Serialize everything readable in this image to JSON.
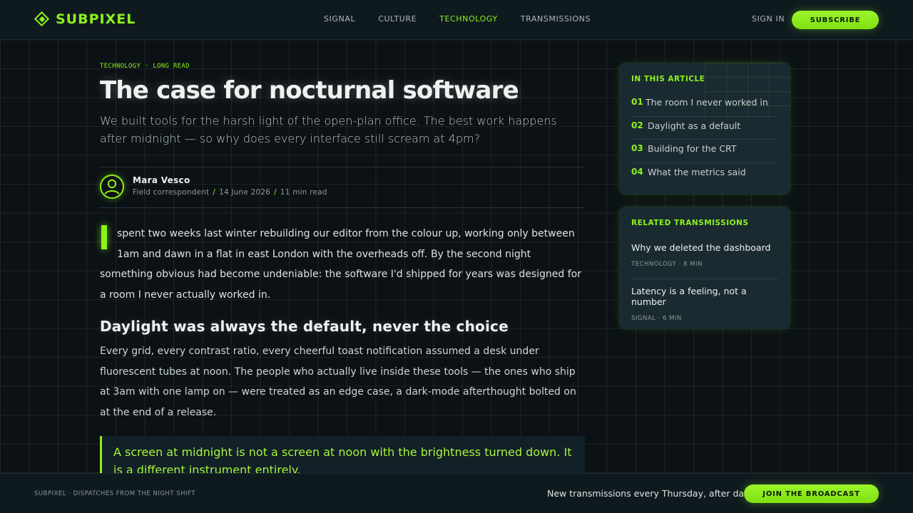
{
  "brand": {
    "name": "SUBPIXEL",
    "accent": "#8cf21b",
    "icon": "diamond-logo-icon"
  },
  "nav": {
    "items": [
      {
        "label": "SIGNAL",
        "active": false
      },
      {
        "label": "CULTURE",
        "active": false
      },
      {
        "label": "TECHNOLOGY",
        "active": true
      },
      {
        "label": "TRANSMISSIONS",
        "active": false
      }
    ],
    "sign_in": "SIGN IN",
    "subscribe": "SUBSCRIBE"
  },
  "article": {
    "kicker": "TECHNOLOGY · LONG READ",
    "title": "The case for nocturnal software",
    "dek": "We built tools for the harsh light of the open-plan office. The best work happens after midnight — so why does every interface still scream at 4pm?",
    "author": "Mara Vesco",
    "role": "Field correspondent",
    "date": "14 June 2026",
    "read_time": "11 min read",
    "meta_separator": "/",
    "avatar_icon": "user-avatar-icon",
    "lead_first_letter": "I",
    "lead_rest": "spent two weeks last winter rebuilding our editor from the colour up, working only between 1am and dawn in a flat in east London with the overheads off. By the second night something obvious had become undeniable: the software I'd shipped for years was designed for a room I never actually worked in.",
    "heading": "Daylight was always the default, never the choice",
    "body": "Every grid, every contrast ratio, every cheerful toast notification assumed a desk under fluorescent tubes at noon. The people who actually live inside these tools — the ones who ship at 3am with one lamp on — were treated as an edge case, a dark-mode afterthought bolted on at the end of a release.",
    "pullquote": "A screen at midnight is not a screen at noon with the brightness turned down. It is a different instrument entirely."
  },
  "toc": {
    "heading": "IN THIS ARTICLE",
    "items": [
      {
        "num": "01",
        "label": "The room I never worked in"
      },
      {
        "num": "02",
        "label": "Daylight as a default"
      },
      {
        "num": "03",
        "label": "Building for the CRT"
      },
      {
        "num": "04",
        "label": "What the metrics said"
      }
    ]
  },
  "related": {
    "heading": "RELATED TRANSMISSIONS",
    "items": [
      {
        "title": "Why we deleted the dashboard",
        "meta": "TECHNOLOGY · 8 MIN"
      },
      {
        "title": "Latency is a feeling, not a number",
        "meta": "SIGNAL · 6 MIN"
      }
    ]
  },
  "footer": {
    "left": "SUBPIXEL · DISPATCHES FROM THE NIGHT SHIFT",
    "tagline": "New transmissions every Thursday, after dark.",
    "cta": "JOIN THE BROADCAST"
  }
}
